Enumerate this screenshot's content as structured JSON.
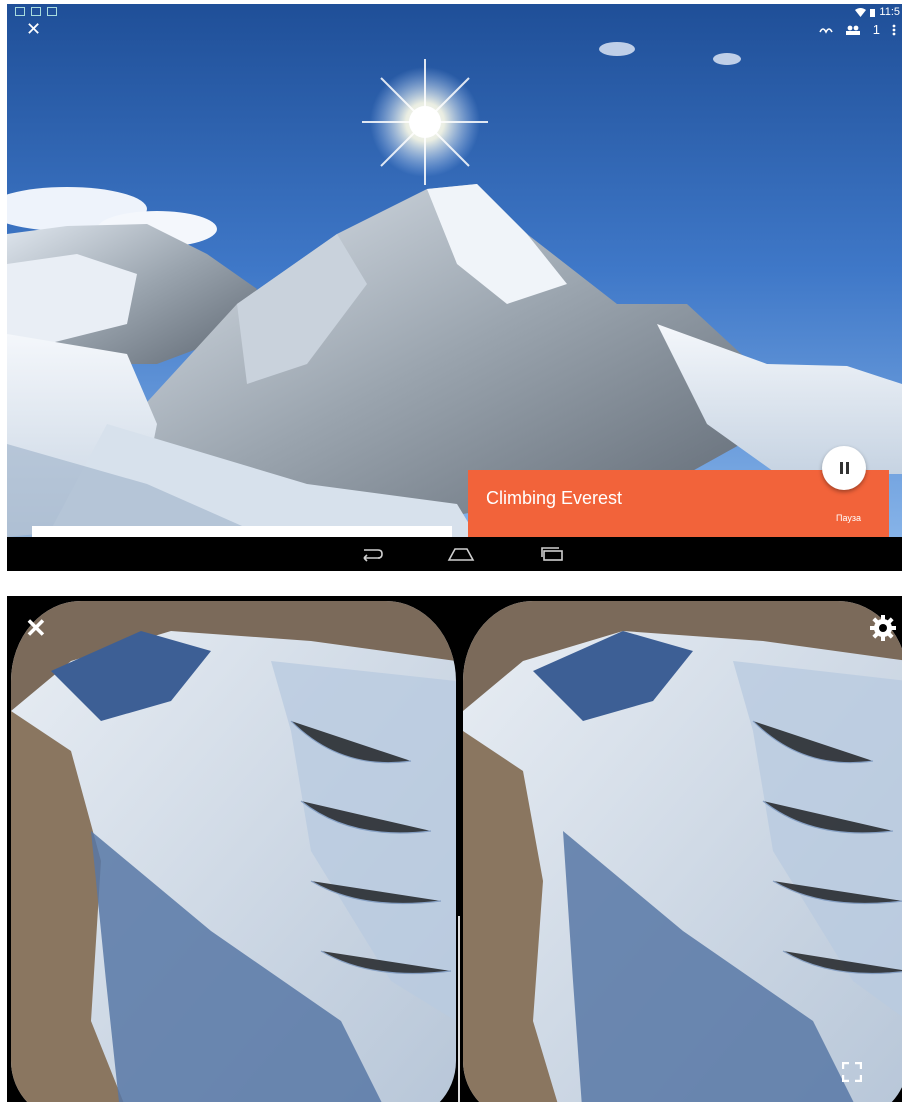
{
  "top_screen": {
    "status": {
      "time": "11:5"
    },
    "actions": {
      "people_count": "1"
    },
    "video": {
      "title": "Climbing Everest",
      "pause_label": "Пауза",
      "progress": 0.5
    }
  },
  "colors": {
    "card": "#f2633a",
    "sky": "#3f78c8",
    "navbar": "#000000"
  },
  "icons": {
    "top": [
      "close-icon",
      "cast-icon",
      "people-icon",
      "more-vert-icon",
      "pause-icon"
    ],
    "navbar": [
      "back-icon",
      "home-icon",
      "recent-apps-icon"
    ],
    "vr": [
      "close-icon",
      "gear-icon",
      "fullscreen-icon"
    ]
  }
}
